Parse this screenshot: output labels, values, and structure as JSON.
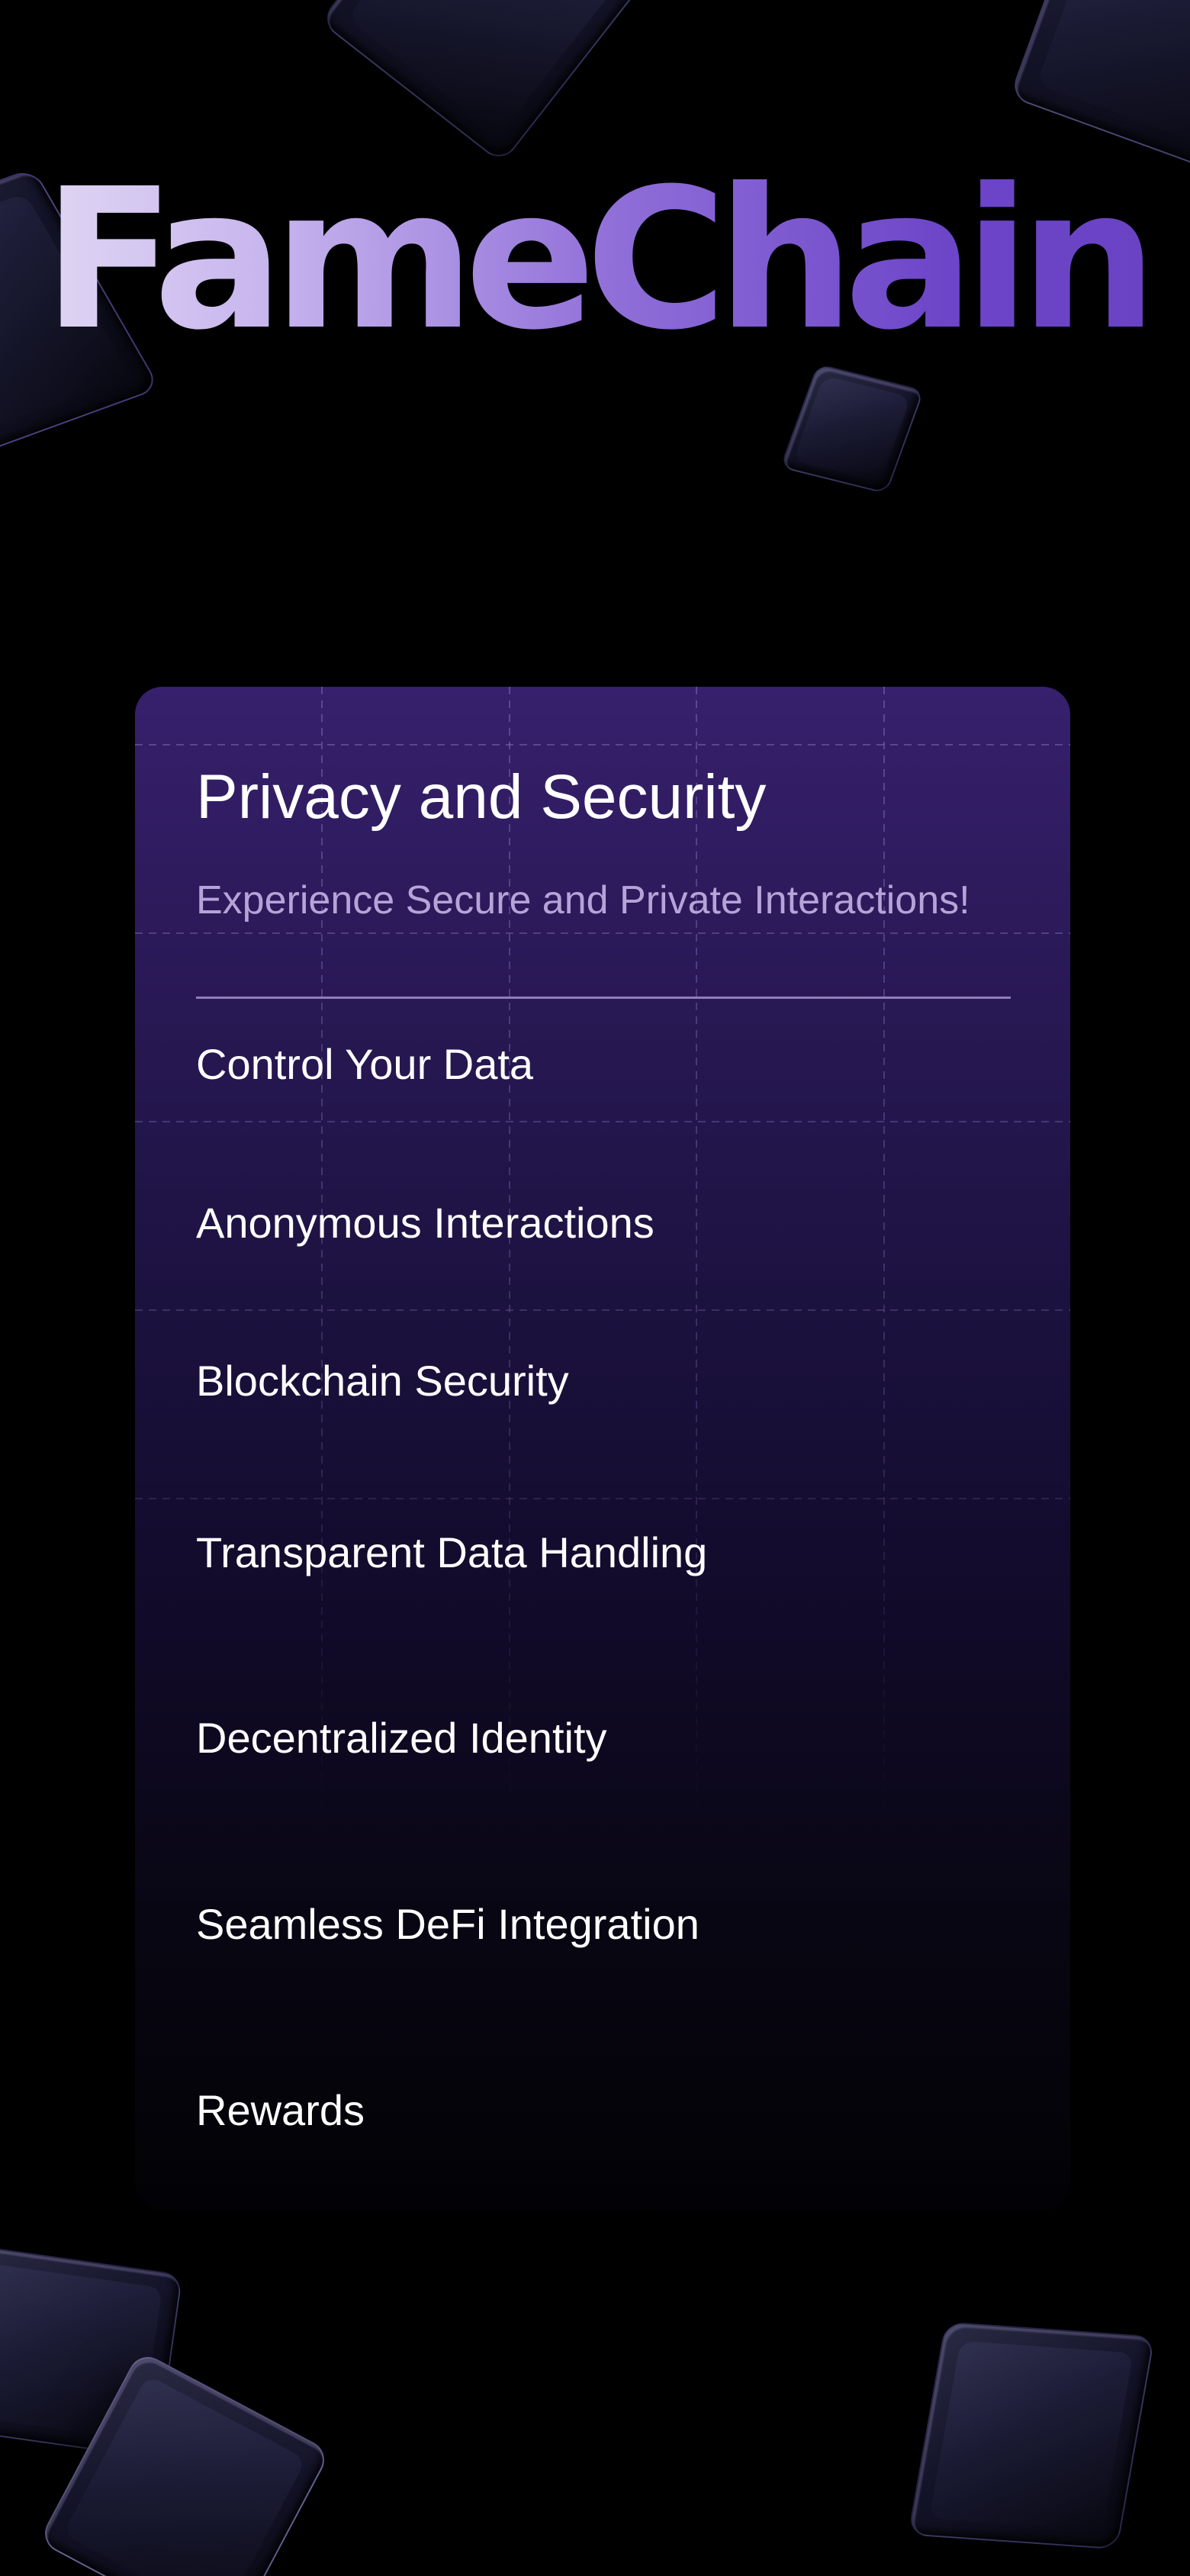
{
  "brand": {
    "logo_text": "FameChain"
  },
  "card": {
    "title": "Privacy and Security",
    "subtitle": "Experience Secure and Private Interactions!",
    "menu_items": [
      {
        "label": "Control Your Data"
      },
      {
        "label": "Anonymous Interactions"
      },
      {
        "label": "Blockchain Security"
      },
      {
        "label": "Transparent Data Handling"
      },
      {
        "label": "Decentralized Identity"
      },
      {
        "label": "Seamless DeFi Integration"
      },
      {
        "label": "Rewards"
      }
    ]
  },
  "colors": {
    "background": "#000000",
    "logo_gradient_start": "#e4dcf4",
    "logo_gradient_end": "#6a42c4",
    "card_top": "#37206d",
    "card_bottom": "#020205",
    "subtitle": "#b6a4d8",
    "divider": "#9a88c4"
  }
}
